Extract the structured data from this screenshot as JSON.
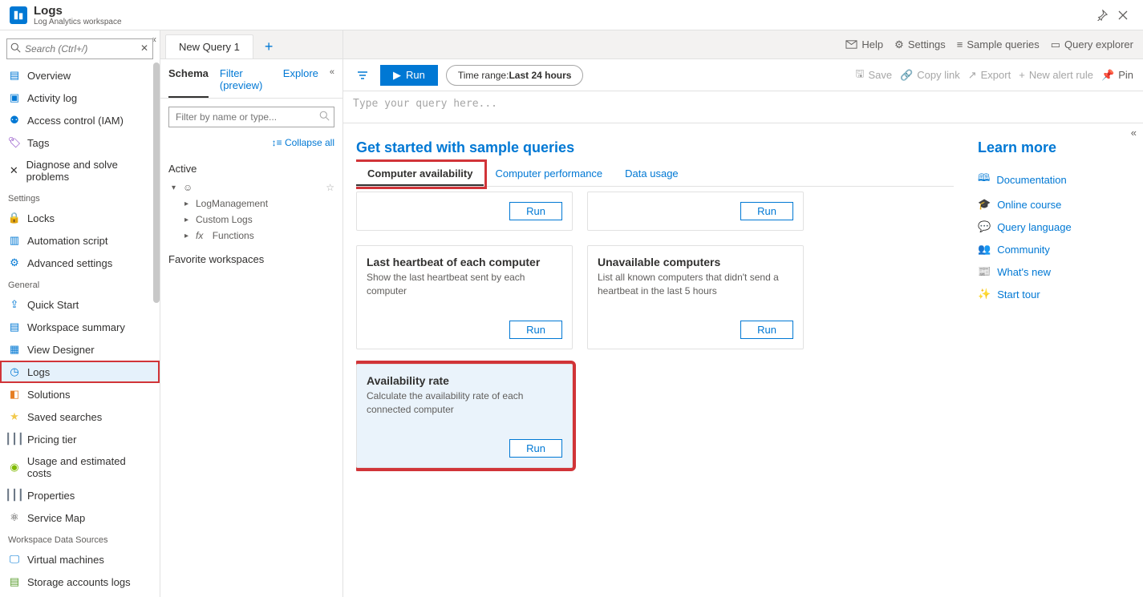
{
  "header": {
    "title": "Logs",
    "subtitle": "Log Analytics workspace"
  },
  "sidebar": {
    "search_placeholder": "Search (Ctrl+/)",
    "items": [
      {
        "label": "Overview",
        "icon": "overview"
      },
      {
        "label": "Activity log",
        "icon": "activity"
      },
      {
        "label": "Access control (IAM)",
        "icon": "access"
      },
      {
        "label": "Tags",
        "icon": "tags"
      },
      {
        "label": "Diagnose and solve problems",
        "icon": "diagnose"
      }
    ],
    "settings_label": "Settings",
    "settings_items": [
      {
        "label": "Locks",
        "icon": "lock"
      },
      {
        "label": "Automation script",
        "icon": "script"
      },
      {
        "label": "Advanced settings",
        "icon": "settings"
      }
    ],
    "general_label": "General",
    "general_items": [
      {
        "label": "Quick Start",
        "icon": "quick"
      },
      {
        "label": "Workspace summary",
        "icon": "summary"
      },
      {
        "label": "View Designer",
        "icon": "view"
      },
      {
        "label": "Logs",
        "icon": "logs",
        "active": true,
        "highlighted": true
      },
      {
        "label": "Solutions",
        "icon": "solutions"
      },
      {
        "label": "Saved searches",
        "icon": "star"
      },
      {
        "label": "Pricing tier",
        "icon": "pricing"
      },
      {
        "label": "Usage and estimated costs",
        "icon": "usage"
      },
      {
        "label": "Properties",
        "icon": "props"
      },
      {
        "label": "Service Map",
        "icon": "map"
      }
    ],
    "datasources_label": "Workspace Data Sources",
    "datasources_items": [
      {
        "label": "Virtual machines",
        "icon": "vm"
      },
      {
        "label": "Storage accounts logs",
        "icon": "storage"
      }
    ]
  },
  "tab": {
    "label": "New Query 1"
  },
  "topbar_tools": {
    "help": "Help",
    "settings": "Settings",
    "sample_queries": "Sample queries",
    "query_explorer": "Query explorer"
  },
  "schema": {
    "tabs": {
      "schema": "Schema",
      "filter": "Filter (preview)",
      "explore": "Explore"
    },
    "filter_placeholder": "Filter by name or type...",
    "collapse_all": "Collapse all",
    "active_label": "Active",
    "tree": [
      {
        "label": "LogManagement"
      },
      {
        "label": "Custom Logs"
      },
      {
        "label": "Functions",
        "fx": true
      }
    ],
    "favorite_label": "Favorite workspaces"
  },
  "action": {
    "run": "Run",
    "time_range_prefix": "Time range: ",
    "time_range_value": "Last 24 hours",
    "save": "Save",
    "copy_link": "Copy link",
    "export": "Export",
    "new_alert": "New alert rule",
    "pin": "Pin"
  },
  "editor": {
    "placeholder": "Type your query here..."
  },
  "samples": {
    "heading": "Get started with sample queries",
    "tabs": [
      {
        "label": "Computer availability",
        "active": true
      },
      {
        "label": "Computer performance"
      },
      {
        "label": "Data usage"
      }
    ],
    "run_label": "Run",
    "cards": [
      {
        "title": "",
        "desc": "",
        "partial": true
      },
      {
        "title": "",
        "desc": "",
        "partial": true
      },
      {
        "title": "Last heartbeat of each computer",
        "desc": "Show the last heartbeat sent by each computer"
      },
      {
        "title": "Unavailable computers",
        "desc": "List all known computers that didn't send a heartbeat in the last 5 hours"
      },
      {
        "title": "Availability rate",
        "desc": "Calculate the availability rate of each connected computer",
        "highlighted": true
      }
    ]
  },
  "learn_more": {
    "heading": "Learn more",
    "links": [
      {
        "label": "Documentation",
        "icon": "book"
      },
      {
        "label": "Online course",
        "icon": "grad"
      },
      {
        "label": "Query language",
        "icon": "chat"
      },
      {
        "label": "Community",
        "icon": "community"
      },
      {
        "label": "What's new",
        "icon": "news"
      },
      {
        "label": "Start tour",
        "icon": "wand"
      }
    ]
  }
}
